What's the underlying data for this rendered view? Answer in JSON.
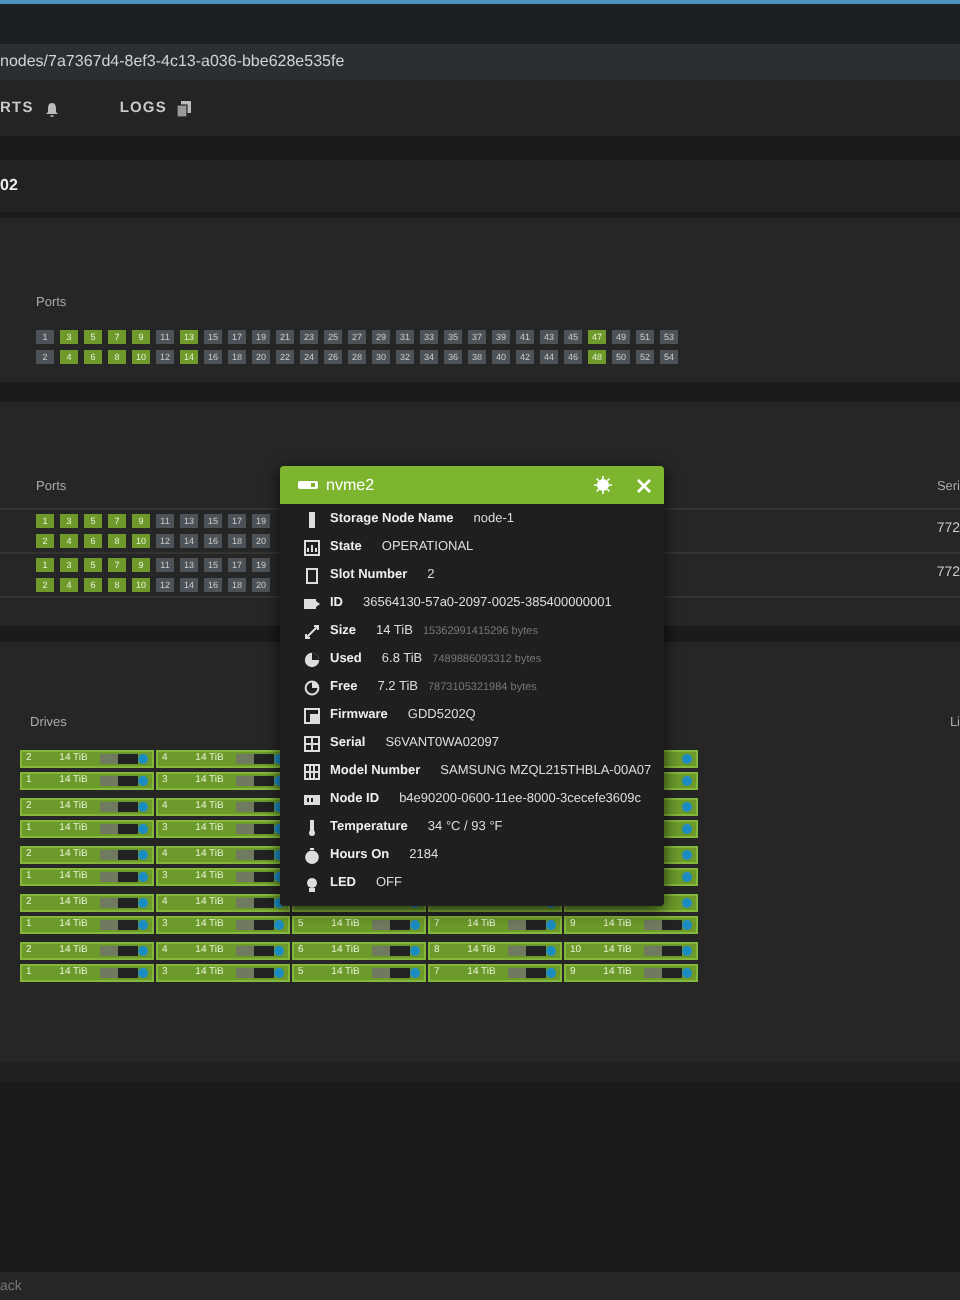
{
  "browser": {
    "url": "nodes/7a7367d4-8ef3-4c13-a036-bbe628e535fe"
  },
  "tabs": [
    {
      "label": "RTS",
      "selected": false
    },
    {
      "label": "LOGS",
      "selected": false
    }
  ],
  "heading": "02",
  "switch_ports": {
    "label": "Ports",
    "rows": [
      [
        {
          "label": "1",
          "active": false
        },
        {
          "label": "3",
          "active": true
        },
        {
          "label": "5",
          "active": true
        },
        {
          "label": "7",
          "active": true
        },
        {
          "label": "9",
          "active": true
        },
        {
          "label": "11",
          "active": false
        },
        {
          "label": "13",
          "active": true
        },
        {
          "label": "15",
          "active": false
        },
        {
          "label": "17",
          "active": false
        },
        {
          "label": "19",
          "active": false
        },
        {
          "label": "21",
          "active": false
        },
        {
          "label": "23",
          "active": false
        },
        {
          "label": "25",
          "active": false
        },
        {
          "label": "27",
          "active": false
        },
        {
          "label": "29",
          "active": false
        },
        {
          "label": "31",
          "active": false
        },
        {
          "label": "33",
          "active": false
        },
        {
          "label": "35",
          "active": false
        },
        {
          "label": "37",
          "active": false
        },
        {
          "label": "39",
          "active": false
        },
        {
          "label": "41",
          "active": false
        },
        {
          "label": "43",
          "active": false
        },
        {
          "label": "45",
          "active": false
        },
        {
          "label": "47",
          "active": true
        },
        {
          "label": "49",
          "active": false
        },
        {
          "label": "51",
          "active": false
        },
        {
          "label": "53",
          "active": false
        }
      ],
      [
        {
          "label": "2",
          "active": false
        },
        {
          "label": "4",
          "active": true
        },
        {
          "label": "6",
          "active": true
        },
        {
          "label": "8",
          "active": true
        },
        {
          "label": "10",
          "active": true
        },
        {
          "label": "12",
          "active": false
        },
        {
          "label": "14",
          "active": true
        },
        {
          "label": "16",
          "active": false
        },
        {
          "label": "18",
          "active": false
        },
        {
          "label": "20",
          "active": false
        },
        {
          "label": "22",
          "active": false
        },
        {
          "label": "24",
          "active": false
        },
        {
          "label": "26",
          "active": false
        },
        {
          "label": "28",
          "active": false
        },
        {
          "label": "30",
          "active": false
        },
        {
          "label": "32",
          "active": false
        },
        {
          "label": "34",
          "active": false
        },
        {
          "label": "36",
          "active": false
        },
        {
          "label": "38",
          "active": false
        },
        {
          "label": "40",
          "active": false
        },
        {
          "label": "42",
          "active": false
        },
        {
          "label": "44",
          "active": false
        },
        {
          "label": "46",
          "active": false
        },
        {
          "label": "48",
          "active": true
        },
        {
          "label": "50",
          "active": false
        },
        {
          "label": "52",
          "active": false
        },
        {
          "label": "54",
          "active": false
        }
      ]
    ]
  },
  "nodes_table": {
    "columns": [
      "Ports",
      "Seri"
    ],
    "rows": [
      {
        "ports": [
          [
            {
              "label": "1",
              "active": true
            },
            {
              "label": "3",
              "active": true
            },
            {
              "label": "5",
              "active": true
            },
            {
              "label": "7",
              "active": true
            },
            {
              "label": "9",
              "active": true
            },
            {
              "label": "11",
              "active": false
            },
            {
              "label": "13",
              "active": false
            },
            {
              "label": "15",
              "active": false
            },
            {
              "label": "17",
              "active": false
            },
            {
              "label": "19",
              "active": false
            }
          ],
          [
            {
              "label": "2",
              "active": true
            },
            {
              "label": "4",
              "active": true
            },
            {
              "label": "6",
              "active": true
            },
            {
              "label": "8",
              "active": true
            },
            {
              "label": "10",
              "active": true
            },
            {
              "label": "12",
              "active": false
            },
            {
              "label": "14",
              "active": false
            },
            {
              "label": "16",
              "active": false
            },
            {
              "label": "18",
              "active": false
            },
            {
              "label": "20",
              "active": false
            }
          ]
        ],
        "column_2": "772"
      },
      {
        "ports": [
          [
            {
              "label": "1",
              "active": true
            },
            {
              "label": "3",
              "active": true
            },
            {
              "label": "5",
              "active": true
            },
            {
              "label": "7",
              "active": true
            },
            {
              "label": "9",
              "active": true
            },
            {
              "label": "11",
              "active": false
            },
            {
              "label": "13",
              "active": false
            },
            {
              "label": "15",
              "active": false
            },
            {
              "label": "17",
              "active": false
            },
            {
              "label": "19",
              "active": false
            }
          ],
          [
            {
              "label": "2",
              "active": true
            },
            {
              "label": "4",
              "active": true
            },
            {
              "label": "6",
              "active": true
            },
            {
              "label": "8",
              "active": true
            },
            {
              "label": "10",
              "active": true
            },
            {
              "label": "12",
              "active": false
            },
            {
              "label": "14",
              "active": false
            },
            {
              "label": "16",
              "active": false
            },
            {
              "label": "18",
              "active": false
            },
            {
              "label": "20",
              "active": false
            }
          ]
        ],
        "column_2": "772"
      }
    ]
  },
  "drives": {
    "columns": [
      "Drives",
      "Li"
    ],
    "rows": [
      [
        {
          "kind": "slot",
          "slot": "2",
          "size": "14 TiB",
          "level": 0.45
        },
        {
          "kind": "slot",
          "slot": "4",
          "size": "14 TiB",
          "level": 0.45
        },
        {
          "kind": "covered"
        },
        {
          "kind": "covered"
        },
        {
          "kind": "covered"
        }
      ],
      [
        {
          "kind": "slot",
          "slot": "1",
          "size": "14 TiB",
          "level": 0.45
        },
        {
          "kind": "slot",
          "slot": "3",
          "size": "14 TiB",
          "level": 0.45
        },
        {
          "kind": "covered"
        },
        {
          "kind": "covered"
        },
        {
          "kind": "covered"
        }
      ],
      [
        {
          "kind": "slot",
          "slot": "2",
          "size": "14 TiB",
          "level": 0.45
        },
        {
          "kind": "slot",
          "slot": "4",
          "size": "14 TiB",
          "level": 0.45
        },
        {
          "kind": "covered"
        },
        {
          "kind": "covered"
        },
        {
          "kind": "covered"
        }
      ],
      [
        {
          "kind": "slot",
          "slot": "1",
          "size": "14 TiB",
          "level": 0.45
        },
        {
          "kind": "slot",
          "slot": "3",
          "size": "14 TiB",
          "level": 0.45
        },
        {
          "kind": "covered"
        },
        {
          "kind": "covered"
        },
        {
          "kind": "covered"
        }
      ],
      [
        {
          "kind": "slot",
          "slot": "2",
          "size": "14 TiB",
          "level": 0.45
        },
        {
          "kind": "slot",
          "slot": "4",
          "size": "14 TiB",
          "level": 0.45
        },
        {
          "kind": "covered"
        },
        {
          "kind": "covered"
        },
        {
          "kind": "covered"
        }
      ],
      [
        {
          "kind": "slot",
          "slot": "1",
          "size": "14 TiB",
          "level": 0.45
        },
        {
          "kind": "slot",
          "slot": "3",
          "size": "14 TiB",
          "level": 0.45
        },
        {
          "kind": "covered"
        },
        {
          "kind": "covered"
        },
        {
          "kind": "covered"
        }
      ],
      [
        {
          "kind": "slot",
          "slot": "2",
          "size": "14 TiB",
          "level": 0.45
        },
        {
          "kind": "slot",
          "slot": "4",
          "size": "14 TiB",
          "level": 0.45
        },
        {
          "kind": "covered"
        },
        {
          "kind": "covered"
        },
        {
          "kind": "covered"
        }
      ],
      [
        {
          "kind": "slot",
          "slot": "1",
          "size": "14 TiB",
          "level": 0.45
        },
        {
          "kind": "slot",
          "slot": "3",
          "size": "14 TiB",
          "level": 0.45
        },
        {
          "kind": "slot",
          "slot": "5",
          "size": "14 TiB",
          "level": 0.45
        },
        {
          "kind": "slot",
          "slot": "7",
          "size": "14 TiB",
          "level": 0.45
        },
        {
          "kind": "slot",
          "slot": "9",
          "size": "14 TiB",
          "level": 0.45
        }
      ],
      [
        {
          "kind": "slot",
          "slot": "2",
          "size": "14 TiB",
          "level": 0.45
        },
        {
          "kind": "slot",
          "slot": "4",
          "size": "14 TiB",
          "level": 0.45
        },
        {
          "kind": "slot",
          "slot": "6",
          "size": "14 TiB",
          "level": 0.45
        },
        {
          "kind": "slot",
          "slot": "8",
          "size": "14 TiB",
          "level": 0.45
        },
        {
          "kind": "slot",
          "slot": "10",
          "size": "14 TiB",
          "level": 0.45
        }
      ],
      [
        {
          "kind": "slot",
          "slot": "1",
          "size": "14 TiB",
          "level": 0.45
        },
        {
          "kind": "slot",
          "slot": "3",
          "size": "14 TiB",
          "level": 0.45
        },
        {
          "kind": "slot",
          "slot": "5",
          "size": "14 TiB",
          "level": 0.45
        },
        {
          "kind": "slot",
          "slot": "7",
          "size": "14 TiB",
          "level": 0.45
        },
        {
          "kind": "slot",
          "slot": "9",
          "size": "14 TiB",
          "level": 0.45
        }
      ]
    ]
  },
  "drive_popup": {
    "title": "nvme2",
    "fields": [
      {
        "label": "Storage Node Name",
        "value": "node-1"
      },
      {
        "label": "State",
        "value": "OPERATIONAL"
      },
      {
        "label": "Slot Number",
        "value": "2"
      },
      {
        "label": "ID",
        "value": "36564130-57a0-2097-0025-385400000001"
      },
      {
        "label": "Size",
        "value": "14 TiB",
        "detail": "15362991415296 bytes"
      },
      {
        "label": "Used",
        "value": "6.8 TiB",
        "detail": "7489886093312 bytes"
      },
      {
        "label": "Free",
        "value": "7.2 TiB",
        "detail": "7873105321984 bytes"
      },
      {
        "label": "Firmware",
        "value": "GDD5202Q"
      },
      {
        "label": "Serial",
        "value": "S6VANT0WA02097"
      },
      {
        "label": "Model Number",
        "value": "SAMSUNG MZQL215THBLA-00A07"
      },
      {
        "label": "Node ID",
        "value": "b4e90200-0600-11ee-8000-3cecefe3609c"
      },
      {
        "label": "Temperature",
        "value": "34 °C / 93 °F"
      },
      {
        "label": "Hours On",
        "value": "2184"
      },
      {
        "label": "LED",
        "value": "OFF"
      }
    ]
  },
  "footer": {
    "text": "ack"
  }
}
